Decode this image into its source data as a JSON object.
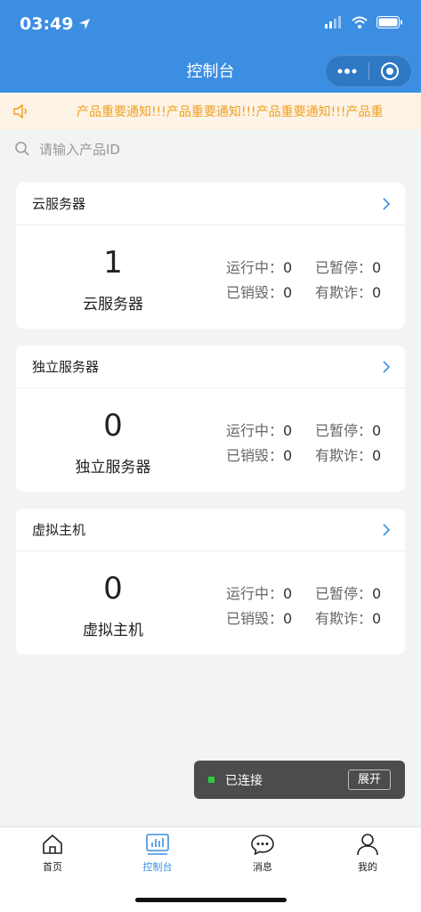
{
  "status_bar": {
    "time": "03:49"
  },
  "header": {
    "title": "控制台"
  },
  "notice": {
    "text": "产品重要通知!!!产品重要通知!!!产品重要通知!!!产品重"
  },
  "search": {
    "placeholder": "请输入产品ID"
  },
  "cards": [
    {
      "title": "云服务器",
      "count": "1",
      "label": "云服务器",
      "running_label": "运行中：",
      "running": "0",
      "paused_label": "已暂停：",
      "paused": "0",
      "destroyed_label": "已销毁：",
      "destroyed": "0",
      "fraud_label": "有欺诈：",
      "fraud": "0"
    },
    {
      "title": "独立服务器",
      "count": "0",
      "label": "独立服务器",
      "running_label": "运行中：",
      "running": "0",
      "paused_label": "已暂停：",
      "paused": "0",
      "destroyed_label": "已销毁：",
      "destroyed": "0",
      "fraud_label": "有欺诈：",
      "fraud": "0"
    },
    {
      "title": "虚拟主机",
      "count": "0",
      "label": "虚拟主机",
      "running_label": "运行中：",
      "running": "0",
      "paused_label": "已暂停：",
      "paused": "0",
      "destroyed_label": "已销毁：",
      "destroyed": "0",
      "fraud_label": "有欺诈：",
      "fraud": "0"
    }
  ],
  "toast": {
    "text": "已连接",
    "button": "展开"
  },
  "tabs": [
    {
      "label": "首页",
      "icon": "home-icon"
    },
    {
      "label": "控制台",
      "icon": "chart-icon"
    },
    {
      "label": "消息",
      "icon": "message-icon"
    },
    {
      "label": "我的",
      "icon": "user-icon"
    }
  ],
  "colors": {
    "primary": "#3c8ee2",
    "notice_text": "#f0a020",
    "notice_bg": "#fdf3e6",
    "toast_dot": "#2ecc40"
  }
}
